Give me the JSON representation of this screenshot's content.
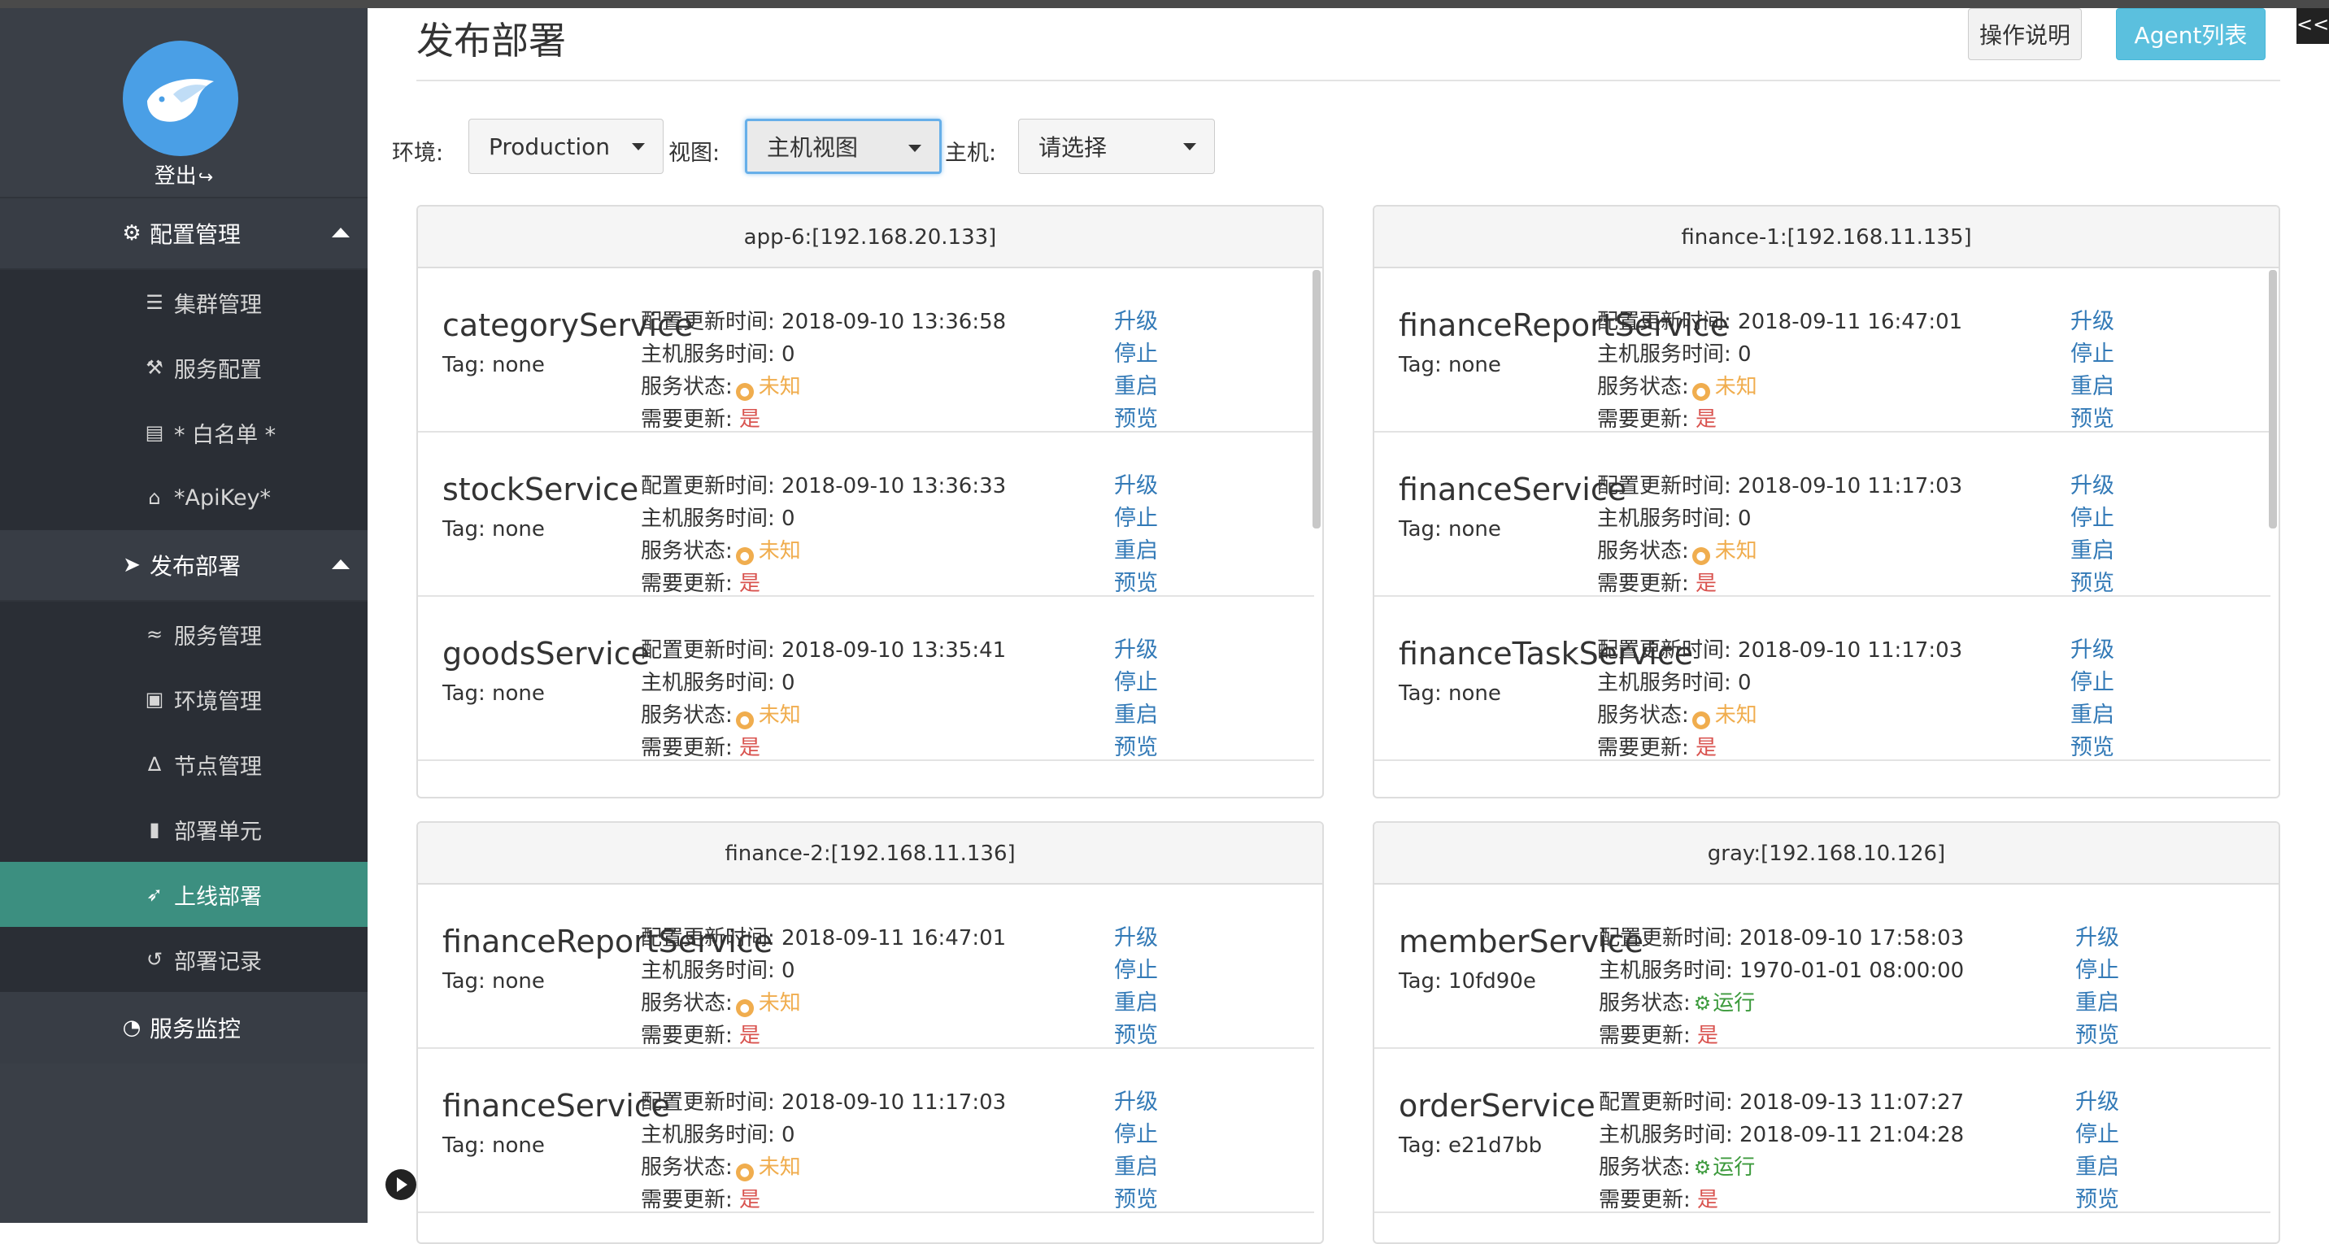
{
  "sidebar": {
    "logout_label": "登出",
    "groups": [
      {
        "label": "配置管理",
        "items": [
          {
            "label": "集群管理",
            "icon": "server-icon"
          },
          {
            "label": "服务配置",
            "icon": "wrench-icon"
          },
          {
            "label": "* 白名单 *",
            "icon": "book-icon"
          },
          {
            "label": "*ApiKey*",
            "icon": "unlock-icon"
          }
        ]
      },
      {
        "label": "发布部署",
        "items": [
          {
            "label": "服务管理",
            "icon": "wifi-icon"
          },
          {
            "label": "环境管理",
            "icon": "archive-icon"
          },
          {
            "label": "节点管理",
            "icon": "linux-icon"
          },
          {
            "label": "部署单元",
            "icon": "chip-icon"
          },
          {
            "label": "上线部署",
            "icon": "rocket-icon"
          },
          {
            "label": "部署记录",
            "icon": "history-icon"
          }
        ]
      }
    ],
    "monitor_label": "服务监控"
  },
  "header": {
    "title": "发布部署",
    "help_button": "操作说明",
    "agent_button": "Agent列表",
    "collapse": "<<"
  },
  "filters": {
    "env_label": "环境:",
    "env_value": "Production",
    "view_label": "视图:",
    "view_value": "主机视图",
    "host_label": "主机:",
    "host_value": "请选择"
  },
  "labels": {
    "updated": "配置更新时间:",
    "host_time": "主机服务时间:",
    "status": "服务状态:",
    "need_update": "需要更新:",
    "tag": "Tag:",
    "actions": [
      "升级",
      "停止",
      "重启",
      "预览"
    ]
  },
  "panels": [
    {
      "title": "app-6:[192.168.20.133]",
      "services": [
        {
          "name": "categoryService",
          "tag": "none",
          "updated": "2018-09-10 13:36:58",
          "host_time": "0",
          "status": "未知",
          "status_kind": "unknown",
          "need_update": "是"
        },
        {
          "name": "stockService",
          "tag": "none",
          "updated": "2018-09-10 13:36:33",
          "host_time": "0",
          "status": "未知",
          "status_kind": "unknown",
          "need_update": "是"
        },
        {
          "name": "goodsService",
          "tag": "none",
          "updated": "2018-09-10 13:35:41",
          "host_time": "0",
          "status": "未知",
          "status_kind": "unknown",
          "need_update": "是"
        }
      ]
    },
    {
      "title": "finance-1:[192.168.11.135]",
      "services": [
        {
          "name": "financeReportService",
          "tag": "none",
          "updated": "2018-09-11 16:47:01",
          "host_time": "0",
          "status": "未知",
          "status_kind": "unknown",
          "need_update": "是"
        },
        {
          "name": "financeService",
          "tag": "none",
          "updated": "2018-09-10 11:17:03",
          "host_time": "0",
          "status": "未知",
          "status_kind": "unknown",
          "need_update": "是"
        },
        {
          "name": "financeTaskService",
          "tag": "none",
          "updated": "2018-09-10 11:17:03",
          "host_time": "0",
          "status": "未知",
          "status_kind": "unknown",
          "need_update": "是"
        }
      ]
    },
    {
      "title": "finance-2:[192.168.11.136]",
      "services": [
        {
          "name": "financeReportService",
          "tag": "none",
          "updated": "2018-09-11 16:47:01",
          "host_time": "0",
          "status": "未知",
          "status_kind": "unknown",
          "need_update": "是"
        },
        {
          "name": "financeService",
          "tag": "none",
          "updated": "2018-09-10 11:17:03",
          "host_time": "0",
          "status": "未知",
          "status_kind": "unknown",
          "need_update": "是"
        }
      ]
    },
    {
      "title": "gray:[192.168.10.126]",
      "services": [
        {
          "name": "memberService",
          "tag": "10fd90e",
          "updated": "2018-09-10 17:58:03",
          "host_time": "1970-01-01 08:00:00",
          "status": "运行",
          "status_kind": "running",
          "need_update": "是"
        },
        {
          "name": "orderService",
          "tag": "e21d7bb",
          "updated": "2018-09-13 11:07:27",
          "host_time": "2018-09-11 21:04:28",
          "status": "运行",
          "status_kind": "running",
          "need_update": "是"
        }
      ]
    }
  ],
  "colors": {
    "sidebar": "#3a3f47",
    "active": "#3c8f80",
    "link": "#337ab7",
    "warn": "#f0ad4e",
    "ok": "#3c9a3c",
    "danger": "#d9534f"
  }
}
